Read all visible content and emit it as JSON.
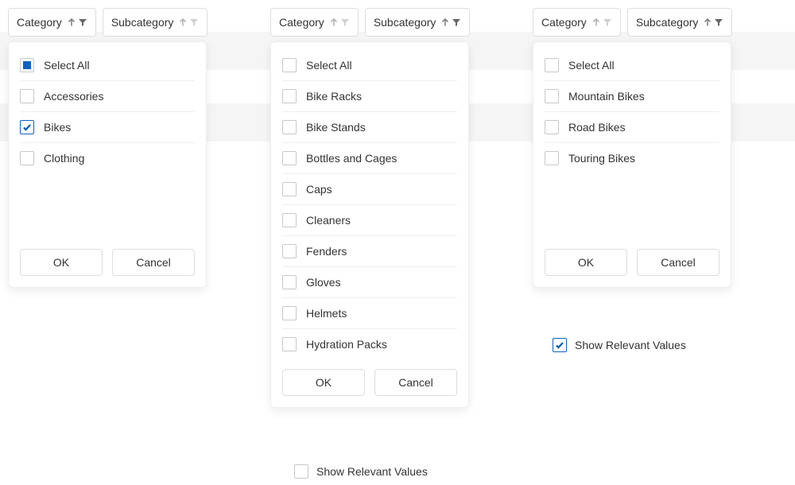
{
  "groups": [
    {
      "headers": [
        {
          "label": "Category",
          "sortActive": true
        },
        {
          "label": "Subcategory",
          "sortActive": false
        }
      ],
      "tall": true,
      "selectAll": {
        "label": "Select All",
        "state": "partial"
      },
      "items": [
        {
          "label": "Accessories",
          "state": "unchecked"
        },
        {
          "label": "Bikes",
          "state": "checked"
        },
        {
          "label": "Clothing",
          "state": "unchecked"
        }
      ],
      "ok": "OK",
      "cancel": "Cancel"
    },
    {
      "headers": [
        {
          "label": "Category",
          "sortActive": false
        },
        {
          "label": "Subcategory",
          "sortActive": true
        }
      ],
      "tall": false,
      "selectAll": {
        "label": "Select All",
        "state": "unchecked"
      },
      "items": [
        {
          "label": "Bike Racks",
          "state": "unchecked"
        },
        {
          "label": "Bike Stands",
          "state": "unchecked"
        },
        {
          "label": "Bottles and Cages",
          "state": "unchecked"
        },
        {
          "label": "Caps",
          "state": "unchecked"
        },
        {
          "label": "Cleaners",
          "state": "unchecked"
        },
        {
          "label": "Fenders",
          "state": "unchecked"
        },
        {
          "label": "Gloves",
          "state": "unchecked"
        },
        {
          "label": "Helmets",
          "state": "unchecked"
        },
        {
          "label": "Hydration Packs",
          "state": "unchecked"
        }
      ],
      "ok": "OK",
      "cancel": "Cancel"
    },
    {
      "headers": [
        {
          "label": "Category",
          "sortActive": false
        },
        {
          "label": "Subcategory",
          "sortActive": true
        }
      ],
      "tall": true,
      "selectAll": {
        "label": "Select All",
        "state": "unchecked"
      },
      "items": [
        {
          "label": "Mountain Bikes",
          "state": "unchecked"
        },
        {
          "label": "Road Bikes",
          "state": "unchecked"
        },
        {
          "label": "Touring Bikes",
          "state": "unchecked"
        }
      ],
      "ok": "OK",
      "cancel": "Cancel"
    }
  ],
  "showRelevant": [
    {
      "label": "Show Relevant Values",
      "state": "unchecked"
    },
    {
      "label": "Show Relevant Values",
      "state": "checked"
    }
  ]
}
